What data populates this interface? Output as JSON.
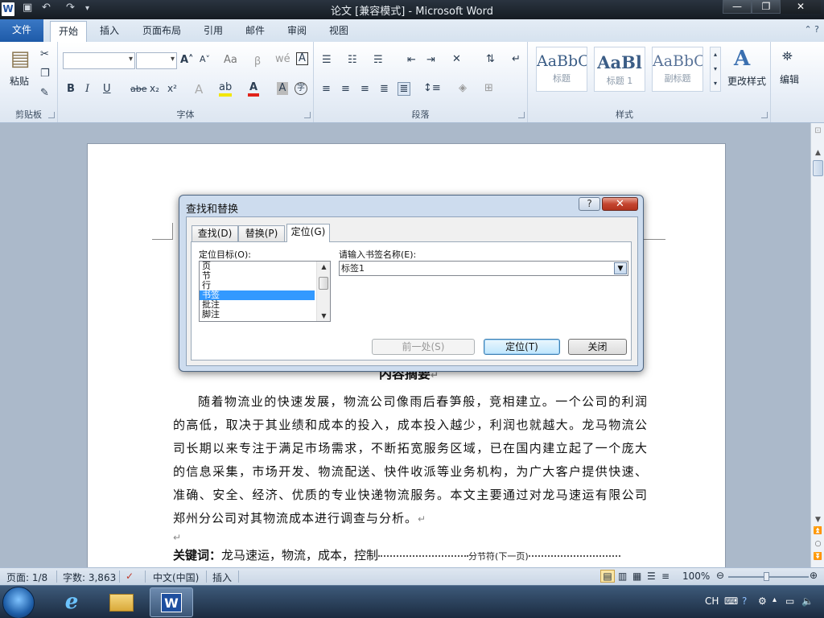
{
  "window": {
    "app_icon": "W",
    "title": "论文 [兼容模式] - Microsoft Word",
    "controls": [
      "—",
      "❐",
      "✕"
    ]
  },
  "ribbon_tabs": [
    "文件",
    "开始",
    "插入",
    "页面布局",
    "引用",
    "邮件",
    "审阅",
    "视图"
  ],
  "ribbon": {
    "clipboard": {
      "paste": "粘贴",
      "label": "剪贴板"
    },
    "font": {
      "label": "字体",
      "bold": "B",
      "italic": "I",
      "underline": "U",
      "strike": "abe",
      "subscript": "x₂",
      "superscript": "x²",
      "grow": "A˄",
      "shrink": "A˅",
      "case": "Aa"
    },
    "paragraph": {
      "label": "段落"
    },
    "styles": {
      "label": "样式",
      "items": [
        {
          "preview": "AaBbC",
          "name": "标题"
        },
        {
          "preview": "AaBl",
          "name": "标题 1"
        },
        {
          "preview": "AaBbC",
          "name": "副标题"
        }
      ],
      "change_styles": "更改样式"
    },
    "editing": {
      "label": "编辑"
    }
  },
  "document": {
    "heading": "内容摘要",
    "paragraph": "随着物流业的快速发展，物流公司像雨后春笋般，竞相建立。一个公司的利润的高低，取决于其业绩和成本的投入，成本投入越少，利润也就越大。龙马物流公司长期以来专注于满足市场需求，不断拓宽服务区域，已在国内建立起了一个庞大的信息采集，市场开发、物流配送、快件收派等业务机构，为广大客户提供快速、准确、安全、经济、优质的专业快递物流服务。本文主要通过对龙马速运有限公司郑州分公司对其物流成本进行调查与分析。",
    "keywords_label": "关键词：",
    "keywords": "龙马速运，物流，成本，控制",
    "section_break": "分节符(下一页)",
    "return_mark": "↵"
  },
  "dialog": {
    "title": "查找和替换",
    "help": "?",
    "close": "✕",
    "tabs": [
      "查找(D)",
      "替换(P)",
      "定位(G)"
    ],
    "active_tab": 2,
    "goto_label": "定位目标(O):",
    "goto_items": [
      "页",
      "节",
      "行",
      "书签",
      "批注",
      "脚注"
    ],
    "selected_index": 3,
    "bookmark_label": "请输入书签名称(E):",
    "bookmark_value": "标签1",
    "buttons": {
      "previous": "前一处(S)",
      "goto": "定位(T)",
      "close": "关闭"
    }
  },
  "statusbar": {
    "page": "页面: 1/8",
    "words": "字数: 3,863",
    "language": "中文(中国)",
    "mode": "插入",
    "zoom": "100%"
  },
  "tray": {
    "ime": "CH"
  }
}
